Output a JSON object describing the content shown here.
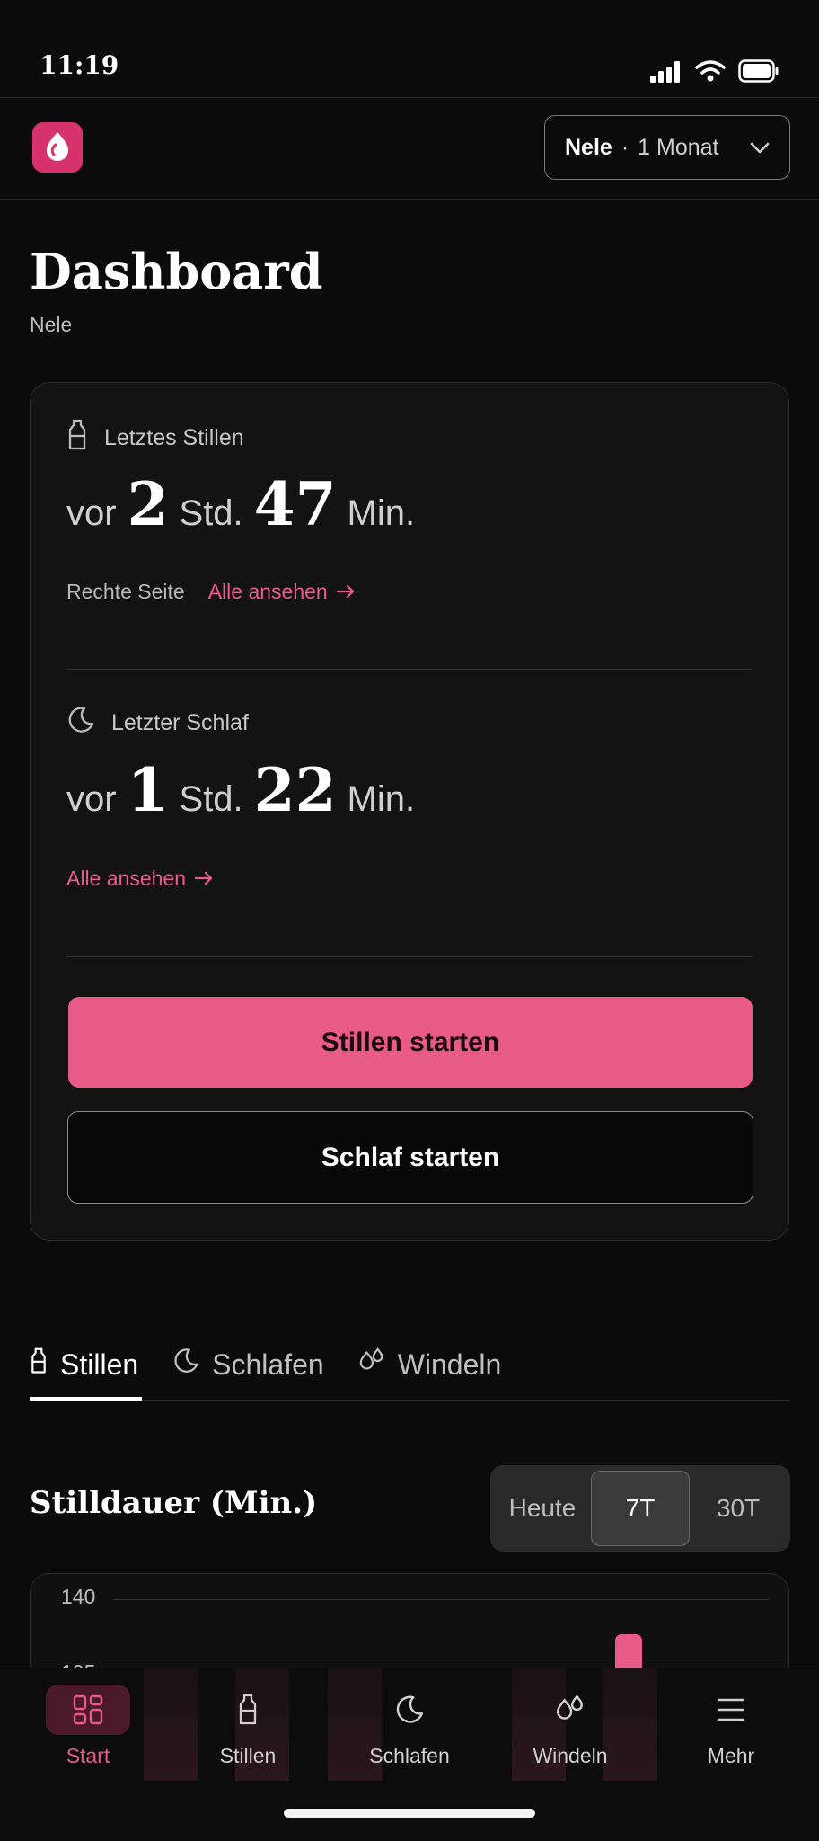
{
  "status_bar": {
    "time": "11:19"
  },
  "header": {
    "child_name": "Nele",
    "separator": "·",
    "child_age": "1 Monat"
  },
  "page": {
    "title": "Dashboard",
    "subtitle": "Nele"
  },
  "summary": {
    "feeding": {
      "label": "Letztes Stillen",
      "prefix": "vor",
      "hours": "2",
      "hours_unit": "Std.",
      "minutes": "47",
      "minutes_unit": "Min.",
      "side": "Rechte Seite",
      "link": "Alle ansehen"
    },
    "sleep": {
      "label": "Letzter Schlaf",
      "prefix": "vor",
      "hours": "1",
      "hours_unit": "Std.",
      "minutes": "22",
      "minutes_unit": "Min.",
      "link": "Alle ansehen"
    },
    "start_feeding_label": "Stillen starten",
    "start_sleep_label": "Schlaf starten"
  },
  "tabs": [
    {
      "label": "Stillen",
      "active": true
    },
    {
      "label": "Schlafen",
      "active": false
    },
    {
      "label": "Windeln",
      "active": false
    }
  ],
  "chart_header": {
    "title": "Stilldauer (Min.)",
    "ranges": [
      "Heute",
      "7T",
      "30T"
    ],
    "selected_range": "7T"
  },
  "chart_data": {
    "type": "bar",
    "title": "Stilldauer (Min.)",
    "y_ticks": [
      "140",
      "105"
    ],
    "ylim": [
      0,
      140
    ],
    "values": [
      null,
      123,
      120,
      null,
      124,
      133,
      null
    ],
    "note": "Bars only partially visible; chart is cut off by the bottom navigation."
  },
  "bottom_nav": [
    {
      "label": "Start",
      "icon": "grid-icon",
      "active": true
    },
    {
      "label": "Stillen",
      "icon": "bottle-icon",
      "active": false
    },
    {
      "label": "Schlafen",
      "icon": "moon-icon",
      "active": false
    },
    {
      "label": "Windeln",
      "icon": "drops-icon",
      "active": false
    },
    {
      "label": "Mehr",
      "icon": "menu-icon",
      "active": false
    }
  ],
  "colors": {
    "accent": "#e85a87",
    "background": "#0b0b0b",
    "card": "#131313",
    "logo": "#d6336c"
  }
}
